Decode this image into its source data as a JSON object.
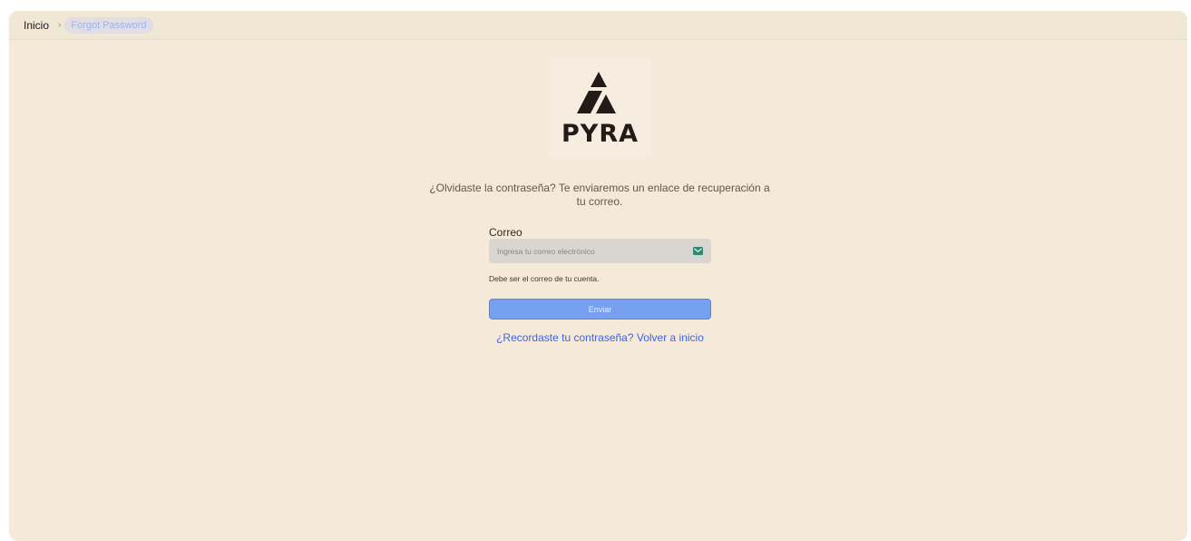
{
  "breadcrumb": {
    "home_label": "Inicio",
    "separator": "›",
    "current_label": "Forgot Password"
  },
  "logo": {
    "text": "PYRA",
    "icon": "pyramid-logo-icon"
  },
  "subtitle": "¿Olvidaste la contraseña? Te enviaremos un enlace de recuperación a tu correo.",
  "form": {
    "email_label": "Correo",
    "email_placeholder": "Ingresa tu correo electrónico",
    "email_value": "",
    "email_icon": "mail-icon",
    "helper_text": "Debe ser el correo de tu cuenta.",
    "submit_label": "Enviar"
  },
  "back_link_label": "¿Recordaste tu contraseña? Volver a inicio",
  "colors": {
    "background": "#f5ead9",
    "primary_button": "#78a0f0",
    "link": "#3e64df",
    "logo_dark": "#231b18",
    "mail_icon": "#2e8a6e"
  }
}
